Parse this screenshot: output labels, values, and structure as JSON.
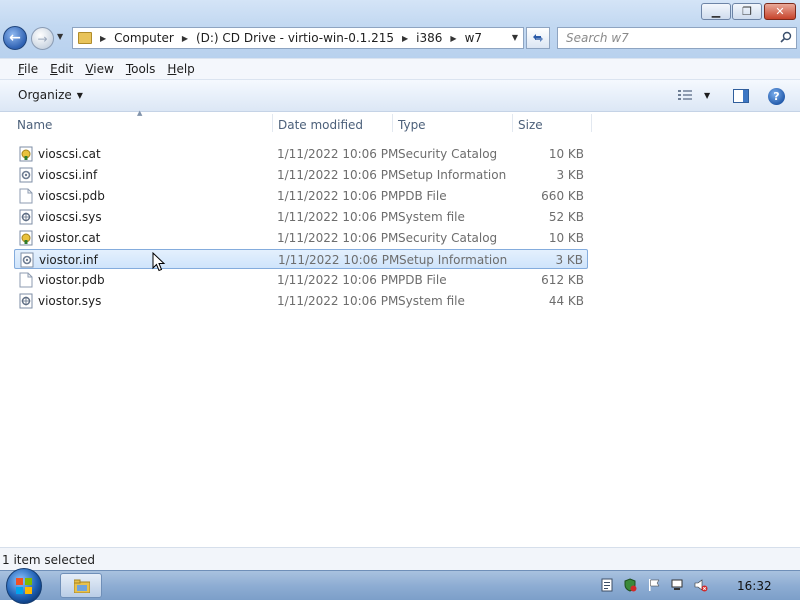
{
  "window": {
    "min_glyph": "▁",
    "max_glyph": "❐",
    "close_glyph": "✕"
  },
  "nav": {
    "back_glyph": "←",
    "forward_glyph": "→",
    "breadcrumbs": [
      "Computer",
      "(D:) CD Drive - virtio-win-0.1.215",
      "i386",
      "w7"
    ],
    "search_placeholder": "Search w7"
  },
  "menu": {
    "items": [
      {
        "label_ul": "F",
        "label_rest": "ile"
      },
      {
        "label_ul": "E",
        "label_rest": "dit"
      },
      {
        "label_ul": "V",
        "label_rest": "iew"
      },
      {
        "label_ul": "T",
        "label_rest": "ools"
      },
      {
        "label_ul": "H",
        "label_rest": "elp"
      }
    ]
  },
  "toolbar": {
    "organize_label": "Organize",
    "help_glyph": "?"
  },
  "columns": {
    "name": "Name",
    "date": "Date modified",
    "type": "Type",
    "size": "Size"
  },
  "files": [
    {
      "name": "vioscsi.cat",
      "date": "1/11/2022 10:06 PM",
      "type": "Security Catalog",
      "size": "10 KB",
      "icon": "security-catalog-icon",
      "selected": false
    },
    {
      "name": "vioscsi.inf",
      "date": "1/11/2022 10:06 PM",
      "type": "Setup Information",
      "size": "3 KB",
      "icon": "setup-information-icon",
      "selected": false
    },
    {
      "name": "vioscsi.pdb",
      "date": "1/11/2022 10:06 PM",
      "type": "PDB File",
      "size": "660 KB",
      "icon": "pdb-file-icon",
      "selected": false
    },
    {
      "name": "vioscsi.sys",
      "date": "1/11/2022 10:06 PM",
      "type": "System file",
      "size": "52 KB",
      "icon": "system-file-icon",
      "selected": false
    },
    {
      "name": "viostor.cat",
      "date": "1/11/2022 10:06 PM",
      "type": "Security Catalog",
      "size": "10 KB",
      "icon": "security-catalog-icon",
      "selected": false
    },
    {
      "name": "viostor.inf",
      "date": "1/11/2022 10:06 PM",
      "type": "Setup Information",
      "size": "3 KB",
      "icon": "setup-information-icon",
      "selected": true
    },
    {
      "name": "viostor.pdb",
      "date": "1/11/2022 10:06 PM",
      "type": "PDB File",
      "size": "612 KB",
      "icon": "pdb-file-icon",
      "selected": false
    },
    {
      "name": "viostor.sys",
      "date": "1/11/2022 10:06 PM",
      "type": "System file",
      "size": "44 KB",
      "icon": "system-file-icon",
      "selected": false
    }
  ],
  "status": {
    "text": "1 item selected"
  },
  "taskbar": {
    "clock": "16:32",
    "tray_icons": [
      "clipboard-icon",
      "security-shield-icon",
      "action-center-flag-icon",
      "network-icon",
      "volume-muted-icon"
    ]
  }
}
